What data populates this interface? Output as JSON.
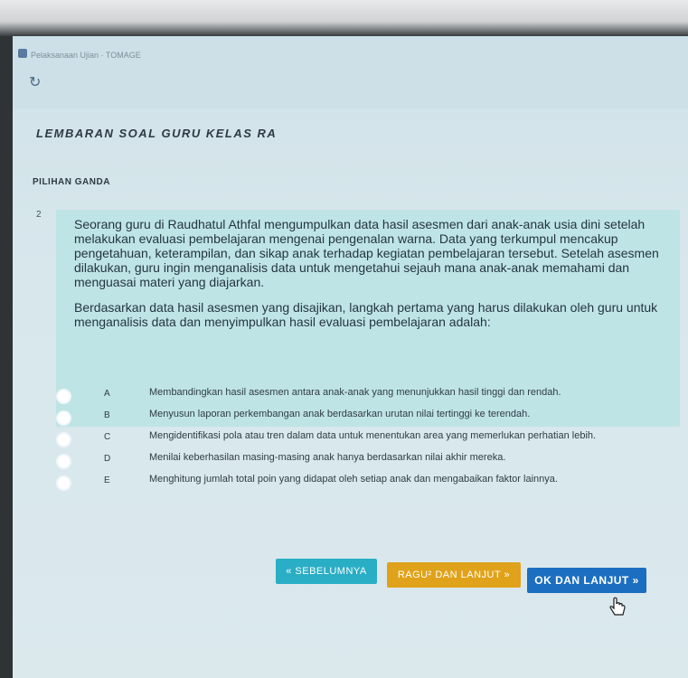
{
  "app": {
    "title": "Pelaksanaan Ujian · TOMAGE"
  },
  "page": {
    "section_title": "LEMBARAN SOAL GURU KELAS RA",
    "subsection": "PILIHAN GANDA"
  },
  "question": {
    "number": "2",
    "paragraph1": "Seorang guru di Raudhatul Athfal mengumpulkan data hasil asesmen dari anak-anak usia dini setelah melakukan evaluasi pembelajaran mengenai pengenalan warna. Data yang terkumpul mencakup pengetahuan, keterampilan, dan sikap anak terhadap kegiatan pembelajaran tersebut. Setelah asesmen dilakukan, guru ingin menganalisis data untuk mengetahui sejauh mana anak-anak memahami dan menguasai materi yang diajarkan.",
    "paragraph2": "Berdasarkan data hasil asesmen yang disajikan, langkah pertama yang harus dilakukan oleh guru untuk menganalisis data dan menyimpulkan hasil evaluasi pembelajaran adalah:"
  },
  "options": [
    {
      "letter": "A",
      "text": "Membandingkan hasil asesmen antara anak-anak yang menunjukkan hasil tinggi dan rendah."
    },
    {
      "letter": "B",
      "text": "Menyusun laporan perkembangan anak berdasarkan urutan nilai tertinggi ke terendah."
    },
    {
      "letter": "C",
      "text": "Mengidentifikasi pola atau tren dalam data untuk menentukan area yang memerlukan perhatian lebih."
    },
    {
      "letter": "D",
      "text": "Menilai keberhasilan masing-masing anak hanya berdasarkan nilai akhir mereka."
    },
    {
      "letter": "E",
      "text": "Menghitung jumlah total poin yang didapat oleh setiap anak dan mengabaikan faktor lainnya."
    }
  ],
  "buttons": {
    "prev": "« SEBELUMNYA",
    "doubt": "RAGU² DAN LANJUT »",
    "next": "OK DAN LANJUT »"
  },
  "colors": {
    "prev": "#29aec5",
    "doubt": "#e0a21a",
    "next": "#1c6fc0",
    "question_bg": "#bfe4e6"
  }
}
